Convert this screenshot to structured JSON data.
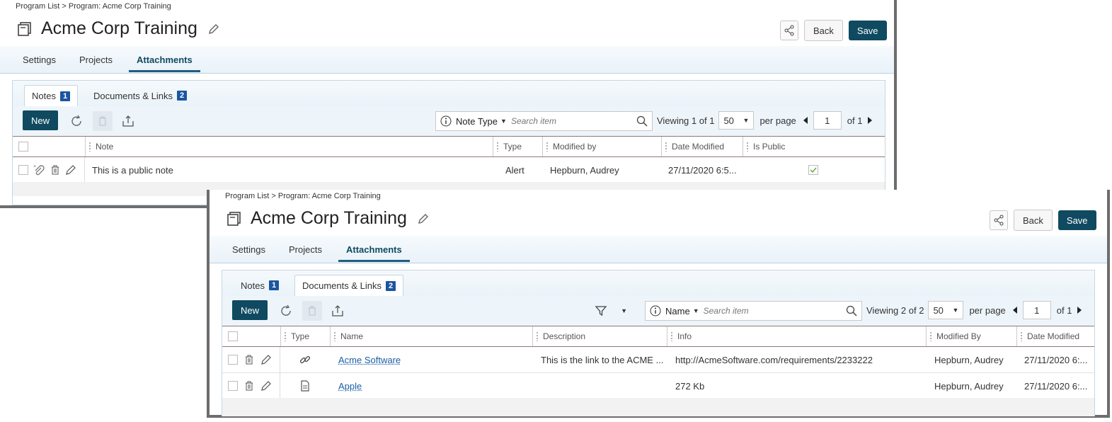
{
  "common": {
    "breadcrumb": "Program List > Program: Acme Corp Training",
    "title": "Acme Corp Training",
    "back_label": "Back",
    "save_label": "Save",
    "main_tabs": [
      "Settings",
      "Projects",
      "Attachments"
    ],
    "sub_tabs": [
      {
        "label": "Notes",
        "count": "1"
      },
      {
        "label": "Documents & Links",
        "count": "2"
      }
    ],
    "new_label": "New",
    "search_placeholder": "Search item",
    "per_page": "50",
    "per_page_label": "per page",
    "page": "1",
    "of_pages": "of 1"
  },
  "notes_panel": {
    "active_sub_tab": "Notes",
    "filter_name": "Note Type",
    "viewing": "Viewing",
    "viewing_count": "1 of 1",
    "columns": [
      "Note",
      "Type",
      "Modified by",
      "Date Modified",
      "Is Public"
    ],
    "rows": [
      {
        "note": "This is a public note",
        "type": "Alert",
        "modified_by": "Hepburn, Audrey",
        "date_modified": "27/11/2020 6:5...",
        "is_public": true
      }
    ]
  },
  "docs_panel": {
    "active_sub_tab": "Documents & Links",
    "filter_name": "Name",
    "viewing": "Viewing",
    "viewing_count": "2 of 2",
    "columns": [
      "Type",
      "Name",
      "Description",
      "Info",
      "Modified By",
      "Date Modified"
    ],
    "rows": [
      {
        "type_icon": "link-icon",
        "name": "Acme Software",
        "description": "This is the link to the ACME ...",
        "info": "http://AcmeSoftware.com/requirements/2233222",
        "modified_by": "Hepburn, Audrey",
        "date_modified": "27/11/2020 6:..."
      },
      {
        "type_icon": "document-icon",
        "name": "Apple",
        "description": "",
        "info": "272 Kb",
        "modified_by": "Hepburn, Audrey",
        "date_modified": "27/11/2020 6:..."
      }
    ]
  },
  "colors": {
    "primary": "#0f4a61",
    "badge": "#1a56a0",
    "link": "#1a5fa5",
    "check": "#6aa84f"
  }
}
